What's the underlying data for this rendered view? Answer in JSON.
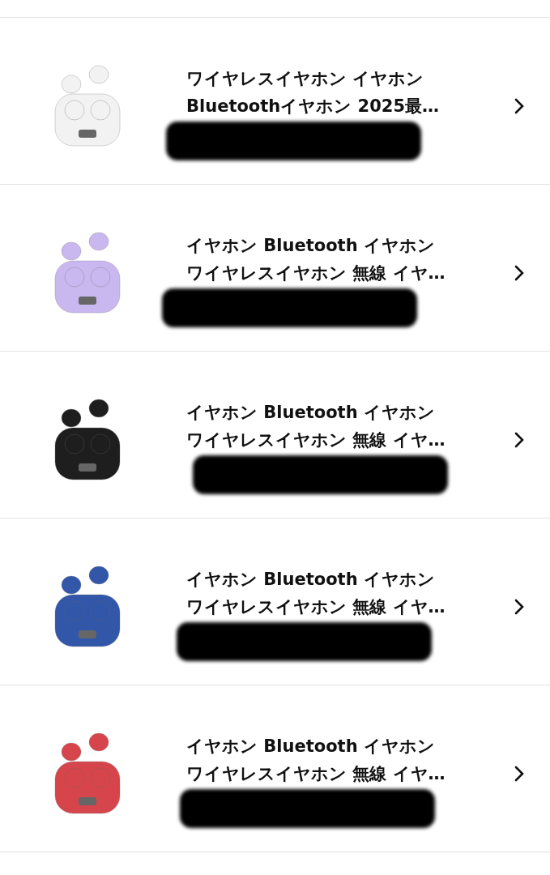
{
  "orders": [
    {
      "title_lines": [
        "ワイヤレスイヤホン イヤホン",
        "Bluetoothイヤホン 2025最…"
      ],
      "color": "#f2f2f2"
    },
    {
      "title_lines": [
        "イヤホン Bluetooth イヤホン",
        "ワイヤレスイヤホン 無線 イヤ…"
      ],
      "color": "#c9b8f0"
    },
    {
      "title_lines": [
        "イヤホン Bluetooth イヤホン",
        "ワイヤレスイヤホン 無線 イヤ…"
      ],
      "color": "#1e1e1e"
    },
    {
      "title_lines": [
        "イヤホン Bluetooth イヤホン",
        "ワイヤレスイヤホン 無線 イヤ…"
      ],
      "color": "#3256a8"
    },
    {
      "title_lines": [
        "イヤホン Bluetooth イヤホン",
        "ワイヤレスイヤホン 無線 イヤ…"
      ],
      "color": "#d6454c"
    }
  ]
}
